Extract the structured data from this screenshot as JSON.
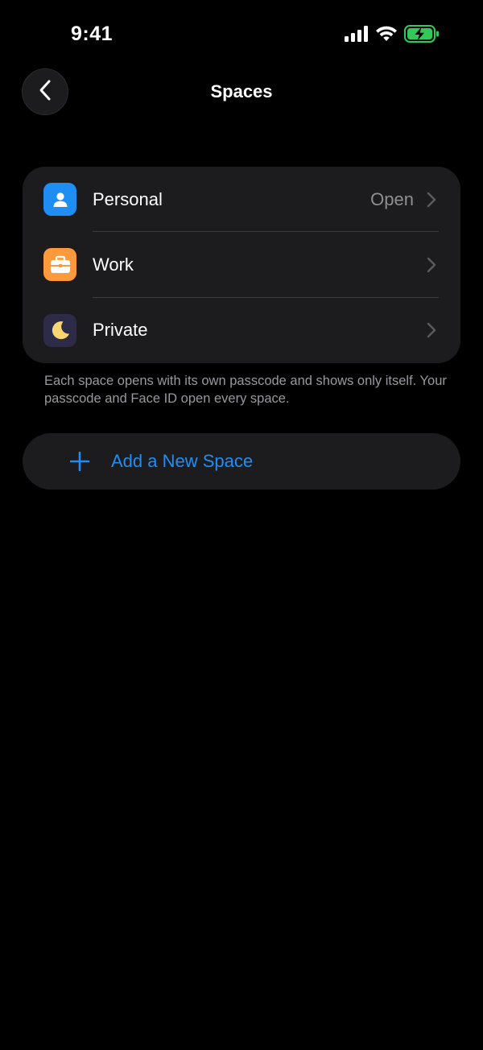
{
  "status_bar": {
    "time": "9:41",
    "icons": [
      "signal-icon",
      "wifi-icon",
      "battery-charging-icon"
    ]
  },
  "nav": {
    "back_icon": "chevron-left-icon",
    "title": "Spaces"
  },
  "spaces": [
    {
      "label": "Personal",
      "detail": "Open",
      "icon": "person-icon",
      "icon_color": "#1e8ef5"
    },
    {
      "label": "Work",
      "detail": "",
      "icon": "briefcase-icon",
      "icon_color": "#ff9a3c"
    },
    {
      "label": "Private",
      "detail": "",
      "icon": "moon-icon",
      "icon_color": "#2d2b45"
    }
  ],
  "footer_note": "Each space opens with its own passcode and shows only itself. Your passcode and Face ID open every space.",
  "add_space": {
    "label": "Add a New Space",
    "icon": "plus-icon"
  },
  "colors": {
    "accent": "#1e8ef5",
    "background": "#000000",
    "card": "#1c1c1e",
    "secondary_text": "#8e8e93",
    "battery": "#34c759"
  }
}
